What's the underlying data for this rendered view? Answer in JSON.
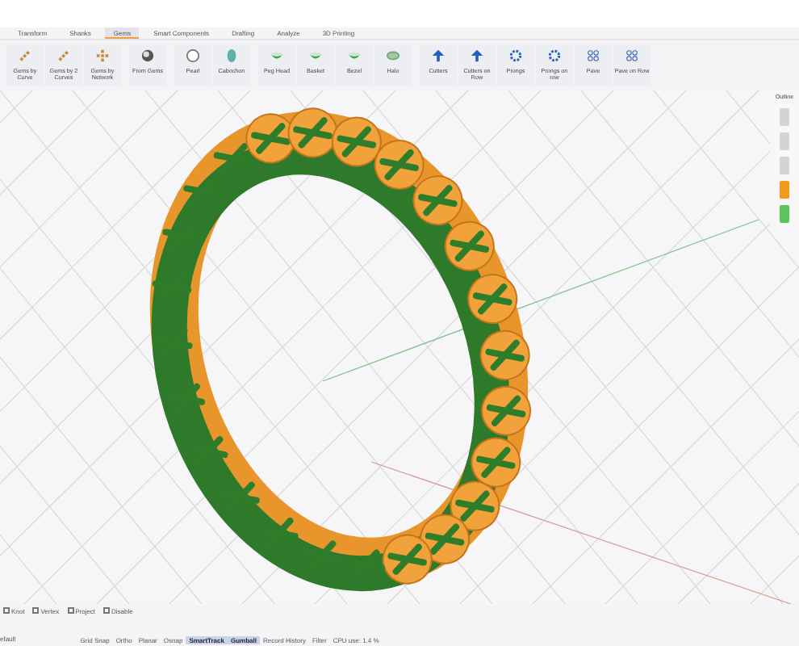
{
  "ribbon_tabs": [
    {
      "label": "Transform",
      "selected": false
    },
    {
      "label": "Shanks",
      "selected": false
    },
    {
      "label": "Gems",
      "selected": true
    },
    {
      "label": "Smart Components",
      "selected": false
    },
    {
      "label": "Drafting",
      "selected": false
    },
    {
      "label": "Analyze",
      "selected": false
    },
    {
      "label": "3D Printing",
      "selected": false
    }
  ],
  "tools": [
    {
      "label": "Gems by Curve",
      "kind": "chain"
    },
    {
      "label": "Gems by 2 Curves",
      "kind": "chain"
    },
    {
      "label": "Gems by Network",
      "kind": "network"
    },
    {
      "label": "From Gems",
      "kind": "gem"
    },
    {
      "label": "Pearl",
      "kind": "pearl"
    },
    {
      "label": "Cabochon",
      "kind": "cabochon"
    },
    {
      "label": "Peg Head",
      "kind": "head"
    },
    {
      "label": "Basket",
      "kind": "head"
    },
    {
      "label": "Bezel",
      "kind": "head"
    },
    {
      "label": "Halo",
      "kind": "halo"
    },
    {
      "label": "Cutters",
      "kind": "cutter"
    },
    {
      "label": "Cutters on Row",
      "kind": "cutter"
    },
    {
      "label": "Prongs",
      "kind": "prong"
    },
    {
      "label": "Prongs on row",
      "kind": "prong"
    },
    {
      "label": "Pave",
      "kind": "pave"
    },
    {
      "label": "Pave on Row",
      "kind": "pave"
    }
  ],
  "layer_panel": {
    "title": "Outline",
    "layers": [
      {
        "color": "#d4d4d4"
      },
      {
        "color": "#d4d4d4"
      },
      {
        "color": "#d4d4d4"
      },
      {
        "color": "#f39a1e"
      },
      {
        "color": "#5cc45a"
      }
    ]
  },
  "osnaps": [
    {
      "label": "Knot",
      "checked": false
    },
    {
      "label": "Vertex",
      "checked": false
    },
    {
      "label": "Project",
      "checked": false
    },
    {
      "label": "Disable",
      "checked": false
    }
  ],
  "status_bar": {
    "layer": "efault",
    "toggles": [
      {
        "label": "Grid Snap",
        "selected": false
      },
      {
        "label": "Ortho",
        "selected": false
      },
      {
        "label": "Planar",
        "selected": false
      },
      {
        "label": "Osnap",
        "selected": false
      },
      {
        "label": "SmartTrack",
        "selected": true
      },
      {
        "label": "Gumball",
        "selected": true
      },
      {
        "label": "Record History",
        "selected": false
      },
      {
        "label": "Filter",
        "selected": false
      }
    ],
    "cpu": "CPU use: 1.4 %"
  }
}
